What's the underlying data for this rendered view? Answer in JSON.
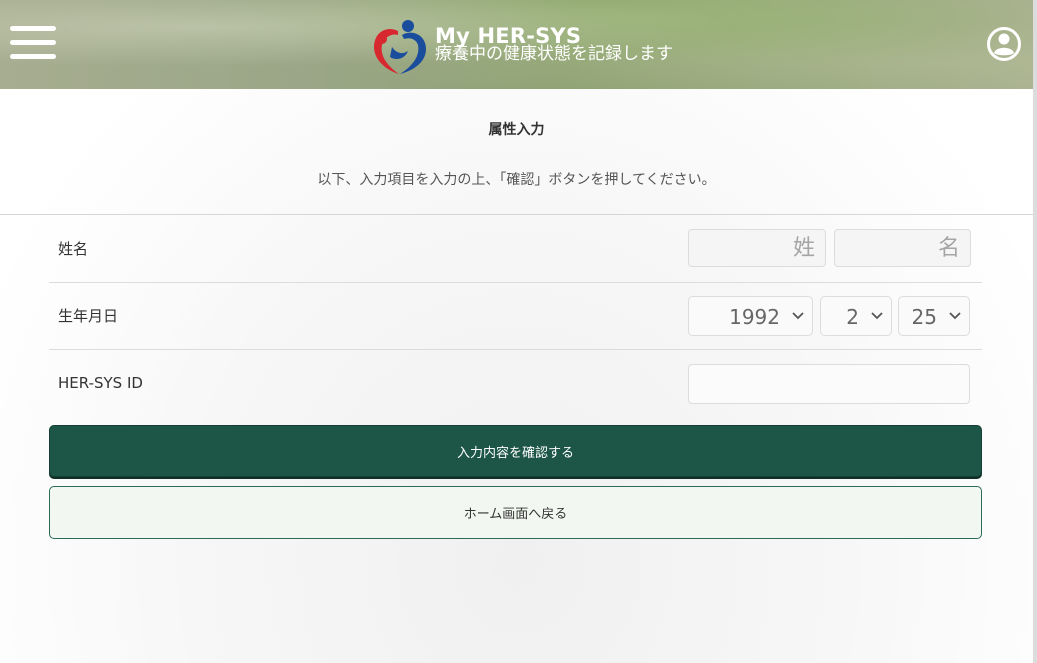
{
  "header": {
    "app_title": "My HER-SYS",
    "app_subtitle": "療養中の健康状態を記録します",
    "menu_icon": "hamburger-menu-icon",
    "user_icon": "user-account-icon",
    "logo_colors": {
      "red": "#d7282f",
      "blue": "#1a4d9c"
    }
  },
  "main": {
    "page_title": "属性入力",
    "instruction": "以下、入力項目を入力の上、「確認」ボタンを押してください。"
  },
  "form": {
    "name": {
      "label": "姓名",
      "last_placeholder": "姓",
      "first_placeholder": "名",
      "last_value": "",
      "first_value": ""
    },
    "birthdate": {
      "label": "生年月日",
      "year": "1992",
      "month": "2",
      "day": "25"
    },
    "hersys_id": {
      "label": "HER-SYS ID",
      "value": ""
    }
  },
  "buttons": {
    "confirm": "入力内容を確認する",
    "back_home": "ホーム画面へ戻る"
  },
  "colors": {
    "primary_button": "#1d5647",
    "secondary_button_border": "#2b6b57",
    "secondary_button_bg": "#f3f7f1"
  }
}
